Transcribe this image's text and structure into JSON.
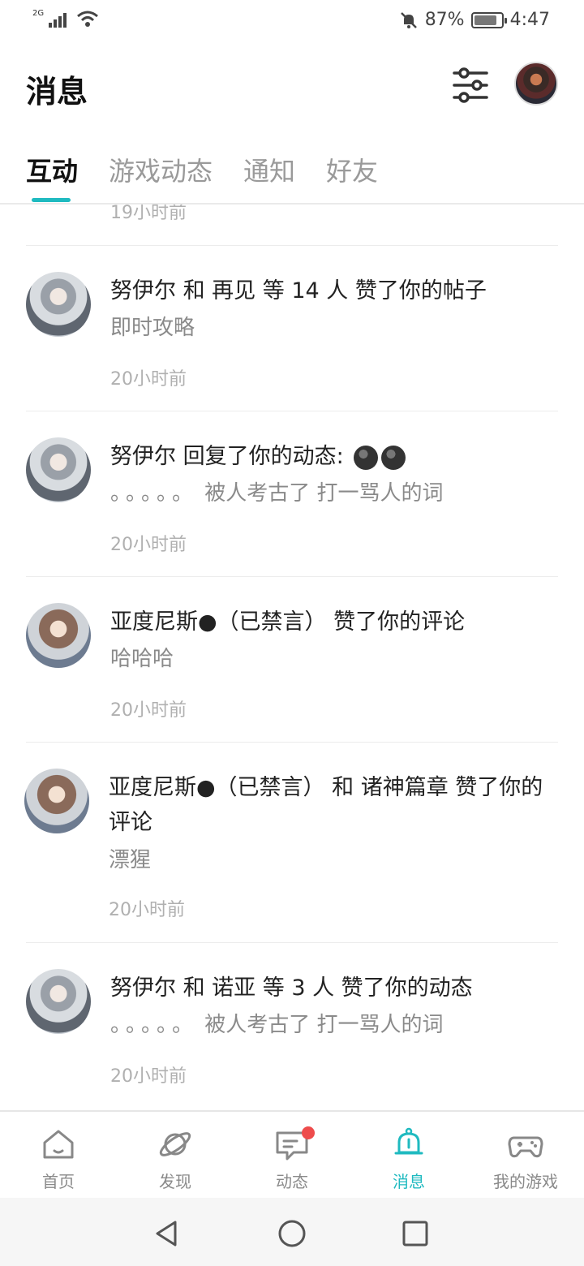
{
  "status_bar": {
    "network": "2G",
    "battery": "87%",
    "battery_level": 0.87,
    "time": "4:47"
  },
  "header": {
    "title": "消息",
    "filter_icon": "sliders-icon",
    "avatar_icon": "user-avatar"
  },
  "tabs": [
    {
      "label": "互动",
      "active": true
    },
    {
      "label": "游戏动态",
      "active": false
    },
    {
      "label": "通知",
      "active": false
    },
    {
      "label": "好友",
      "active": false
    }
  ],
  "feed": {
    "partial_time": "19小时前",
    "items": [
      {
        "title": "努伊尔 和 再见 等 14 人 赞了你的帖子",
        "sub": "即时攻略",
        "time": "20小时前"
      },
      {
        "title": "努伊尔 回复了你的动态:",
        "dots": "。。。。。",
        "sub": "被人考古了 打一骂人的词",
        "time": "20小时前"
      },
      {
        "title": "亚度尼斯●（已禁言） 赞了你的评论",
        "sub": "哈哈哈",
        "time": "20小时前"
      },
      {
        "title": "亚度尼斯●（已禁言） 和 诸神篇章 赞了你的评论",
        "sub": "漂猩",
        "time": "20小时前"
      },
      {
        "title": "努伊尔 和 诺亚 等 3 人 赞了你的动态",
        "dots": "。。。。。",
        "sub": "被人考古了 打一骂人的词",
        "time": "20小时前"
      }
    ]
  },
  "tabbar": [
    {
      "label": "首页",
      "icon": "home-icon",
      "active": false
    },
    {
      "label": "发现",
      "icon": "planet-icon",
      "active": false
    },
    {
      "label": "动态",
      "icon": "chat-icon",
      "active": false,
      "badge": true
    },
    {
      "label": "消息",
      "icon": "bell-icon",
      "active": true
    },
    {
      "label": "我的游戏",
      "icon": "gamepad-icon",
      "active": false
    }
  ],
  "colors": {
    "accent": "#1fbac0",
    "badge": "#ee4c4c"
  }
}
